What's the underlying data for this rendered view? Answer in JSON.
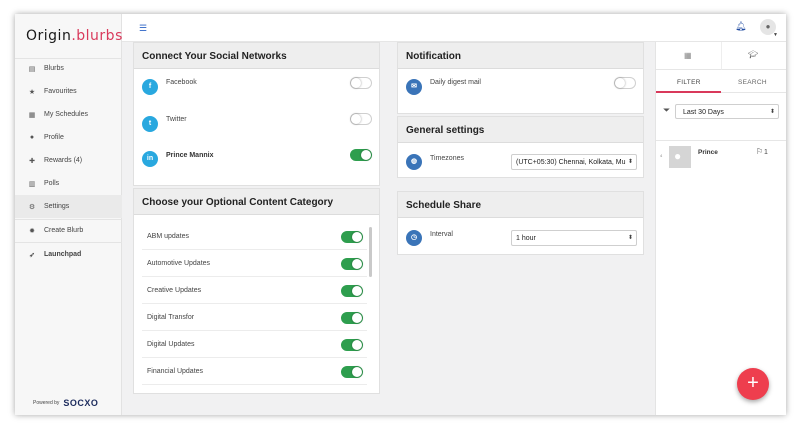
{
  "brand": {
    "logo_origin": "Origin",
    "logo_blurbs": "blurbs",
    "powered_by": "Powered by",
    "socxo": "SOCXO"
  },
  "sidebar": {
    "items": [
      {
        "label": "Blurbs",
        "icon": "file-icon"
      },
      {
        "label": "Favourites",
        "icon": "star-icon"
      },
      {
        "label": "My Schedules",
        "icon": "calendar-icon"
      },
      {
        "label": "Profile",
        "icon": "user-icon"
      },
      {
        "label": "Rewards (4)",
        "icon": "gift-icon"
      },
      {
        "label": "Polls",
        "icon": "bar-chart-icon"
      },
      {
        "label": "Settings",
        "icon": "gears-icon",
        "active": true
      },
      {
        "label": "Create Blurb",
        "icon": "gear-icon"
      },
      {
        "label": "Launchpad",
        "icon": "rocket-icon"
      }
    ]
  },
  "social": {
    "title": "Connect Your Social Networks",
    "networks": [
      {
        "name": "Facebook",
        "letter": "f",
        "color": "#29a8df",
        "connected": false
      },
      {
        "name": "Twitter",
        "letter": "t",
        "color": "#29a8df",
        "connected": false
      },
      {
        "name": "Prince Mannix",
        "letter": "in",
        "color": "#29a8df",
        "connected": true
      }
    ]
  },
  "categories": {
    "title": "Choose your Optional Content Category",
    "items": [
      "ABM updates",
      "Automotive Updates",
      "Creative Updates",
      "Digital Transfor",
      "Digital Updates",
      "Financial Updates"
    ]
  },
  "notification": {
    "title": "Notification",
    "daily_digest": "Daily digest mail"
  },
  "general": {
    "title": "General settings",
    "timezones_label": "Timezones",
    "timezone_value": "(UTC+05:30) Chennai, Kolkata, Mu"
  },
  "schedule": {
    "title": "Schedule Share",
    "interval_label": "Interval",
    "interval_value": "1 hour"
  },
  "right_panel": {
    "tab_filter": "FILTER",
    "tab_search": "SEARCH",
    "range": "Last 30 Days",
    "user_name": "Prince",
    "bookmark_count": "1",
    "row_marker": "4"
  },
  "colors": {
    "accent_red": "#d9395b",
    "toggle_on": "#2e9e4e",
    "social_blue": "#29a8df",
    "fab": "#ee3e4e"
  }
}
